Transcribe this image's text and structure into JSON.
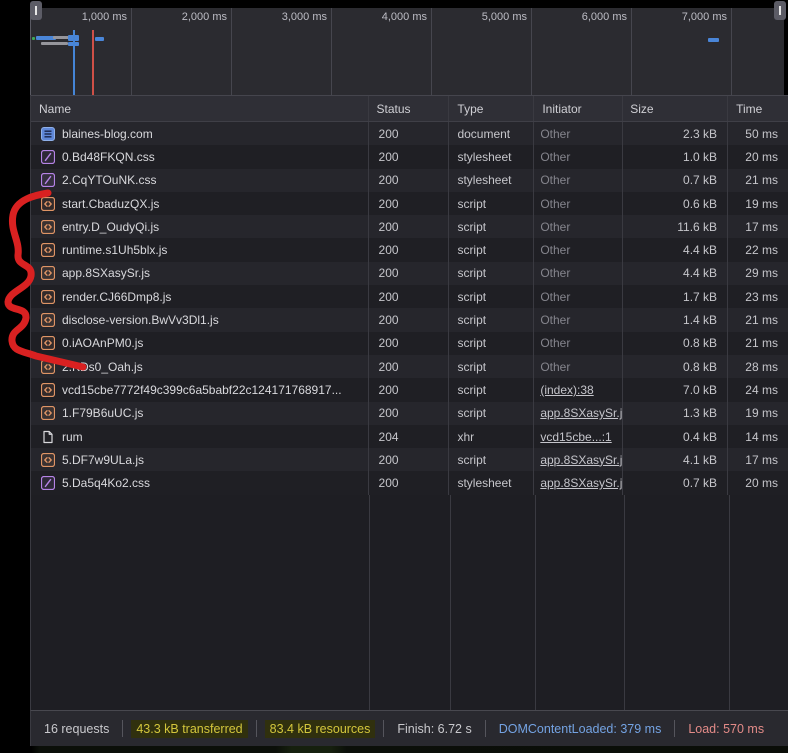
{
  "timeline": {
    "tick_labels": [
      "1,000 ms",
      "2,000 ms",
      "3,000 ms",
      "4,000 ms",
      "5,000 ms",
      "6,000 ms",
      "7,000 ms"
    ],
    "dcl_marker_color": "#4585d6",
    "load_marker_color": "#cf5047",
    "bar_blue": "#4a86d8",
    "bar_gray": "#96969c",
    "bar_green": "#3fa755"
  },
  "table": {
    "columns": [
      "Name",
      "Status",
      "Type",
      "Initiator",
      "Size",
      "Time"
    ],
    "rows": [
      {
        "name": "blaines-blog.com",
        "icon": "document-icon",
        "status": "200",
        "type": "document",
        "initiator": "Other",
        "initiator_is_link": false,
        "size": "2.3 kB",
        "time": "50 ms"
      },
      {
        "name": "0.Bd48FKQN.css",
        "icon": "stylesheet-icon",
        "status": "200",
        "type": "stylesheet",
        "initiator": "Other",
        "initiator_is_link": false,
        "size": "1.0 kB",
        "time": "20 ms"
      },
      {
        "name": "2.CqYTOuNK.css",
        "icon": "stylesheet-icon",
        "status": "200",
        "type": "stylesheet",
        "initiator": "Other",
        "initiator_is_link": false,
        "size": "0.7 kB",
        "time": "21 ms"
      },
      {
        "name": "start.CbaduzQX.js",
        "icon": "script-icon",
        "status": "200",
        "type": "script",
        "initiator": "Other",
        "initiator_is_link": false,
        "size": "0.6 kB",
        "time": "19 ms"
      },
      {
        "name": "entry.D_OudyQi.js",
        "icon": "script-icon",
        "status": "200",
        "type": "script",
        "initiator": "Other",
        "initiator_is_link": false,
        "size": "11.6 kB",
        "time": "17 ms"
      },
      {
        "name": "runtime.s1Uh5blx.js",
        "icon": "script-icon",
        "status": "200",
        "type": "script",
        "initiator": "Other",
        "initiator_is_link": false,
        "size": "4.4 kB",
        "time": "22 ms"
      },
      {
        "name": "app.8SXasySr.js",
        "icon": "script-icon",
        "status": "200",
        "type": "script",
        "initiator": "Other",
        "initiator_is_link": false,
        "size": "4.4 kB",
        "time": "29 ms"
      },
      {
        "name": "render.CJ66Dmp8.js",
        "icon": "script-icon",
        "status": "200",
        "type": "script",
        "initiator": "Other",
        "initiator_is_link": false,
        "size": "1.7 kB",
        "time": "23 ms"
      },
      {
        "name": "disclose-version.BwVv3Dl1.js",
        "icon": "script-icon",
        "status": "200",
        "type": "script",
        "initiator": "Other",
        "initiator_is_link": false,
        "size": "1.4 kB",
        "time": "21 ms"
      },
      {
        "name": "0.iAOAnPM0.js",
        "icon": "script-icon",
        "status": "200",
        "type": "script",
        "initiator": "Other",
        "initiator_is_link": false,
        "size": "0.8 kB",
        "time": "21 ms"
      },
      {
        "name": "2.KDs0_Oah.js",
        "icon": "script-icon",
        "status": "200",
        "type": "script",
        "initiator": "Other",
        "initiator_is_link": false,
        "size": "0.8 kB",
        "time": "28 ms"
      },
      {
        "name": "vcd15cbe7772f49c399c6a5babf22c124171768917...",
        "icon": "script-icon",
        "status": "200",
        "type": "script",
        "initiator": "(index):38",
        "initiator_is_link": true,
        "size": "7.0 kB",
        "time": "24 ms"
      },
      {
        "name": "1.F79B6uUC.js",
        "icon": "script-icon",
        "status": "200",
        "type": "script",
        "initiator": "app.8SXasySr.j",
        "initiator_is_link": true,
        "size": "1.3 kB",
        "time": "19 ms"
      },
      {
        "name": "rum",
        "icon": "file-icon",
        "status": "204",
        "type": "xhr",
        "initiator": "vcd15cbe...:1",
        "initiator_is_link": true,
        "size": "0.4 kB",
        "time": "14 ms"
      },
      {
        "name": "5.DF7w9ULa.js",
        "icon": "script-icon",
        "status": "200",
        "type": "script",
        "initiator": "app.8SXasySr.j",
        "initiator_is_link": true,
        "size": "4.1 kB",
        "time": "17 ms"
      },
      {
        "name": "5.Da5q4Ko2.css",
        "icon": "stylesheet-icon",
        "status": "200",
        "type": "stylesheet",
        "initiator": "app.8SXasySr.j",
        "initiator_is_link": true,
        "size": "0.7 kB",
        "time": "20 ms"
      }
    ]
  },
  "footer": {
    "requests": "16 requests",
    "transferred": "43.3 kB transferred",
    "resources": "83.4 kB resources",
    "finish": "Finish: 6.72 s",
    "dom_content_loaded": "DOMContentLoaded: 379 ms",
    "load": "Load: 570 ms"
  },
  "colors": {
    "warning_text": "#d3c63c",
    "dcl_text": "#74a3e3",
    "load_text": "#e38b88",
    "annotation_red": "#d92121"
  }
}
